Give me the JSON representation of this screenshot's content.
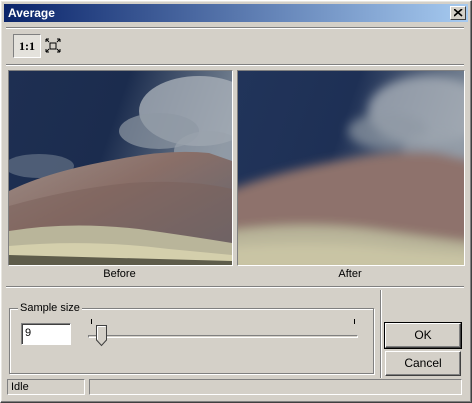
{
  "window": {
    "title": "Average"
  },
  "toolbar": {
    "actual_size_label": "1:1",
    "fit_icon": "fit-to-window-icon"
  },
  "preview": {
    "before_caption": "Before",
    "after_caption": "After"
  },
  "sample": {
    "group_label": "Sample size",
    "value": "9",
    "slider_position": 0.03
  },
  "buttons": {
    "ok_label": "OK",
    "cancel_label": "Cancel"
  },
  "status": {
    "text": "Idle",
    "secondary": ""
  },
  "colors": {
    "title_start": "#0a246a",
    "title_end": "#a6caf0",
    "face": "#d4d0c8"
  }
}
